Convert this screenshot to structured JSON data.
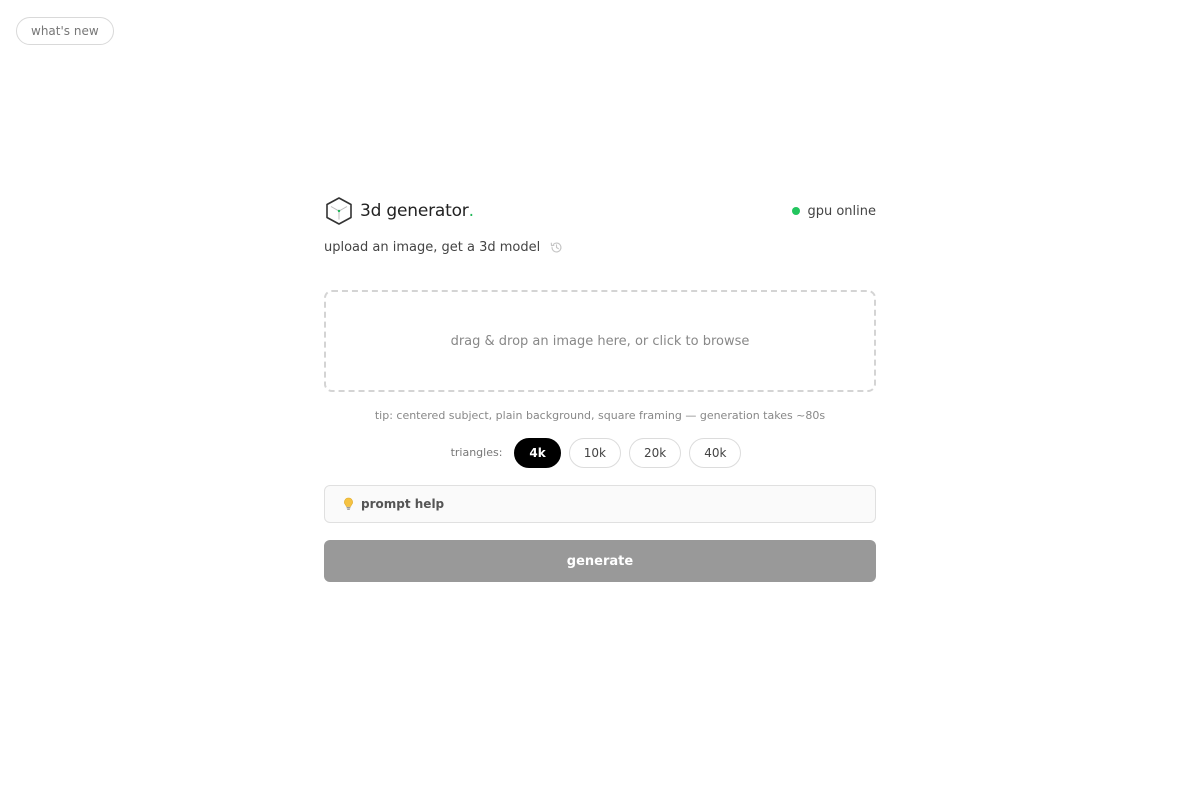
{
  "top": {
    "whats_new_label": "what's new"
  },
  "header": {
    "brand_name": "3d generator",
    "brand_dot": ".",
    "status_label": "gpu online",
    "status_color": "#22c55e",
    "logo_icon": "cube-icon"
  },
  "subtitle": {
    "text": "upload an image, get a 3d model",
    "history_icon": "history-icon"
  },
  "dropzone": {
    "text": "drag & drop an image here, or click to browse"
  },
  "tip": {
    "text": "tip: centered subject, plain background, square framing — generation takes ~80s"
  },
  "triangles": {
    "label": "triangles:",
    "options": [
      "4k",
      "10k",
      "20k",
      "40k"
    ],
    "selected": "4k"
  },
  "prompt_help": {
    "label": "prompt help",
    "icon": "lightbulb-icon"
  },
  "generate": {
    "label": "generate",
    "color": "#999999"
  }
}
